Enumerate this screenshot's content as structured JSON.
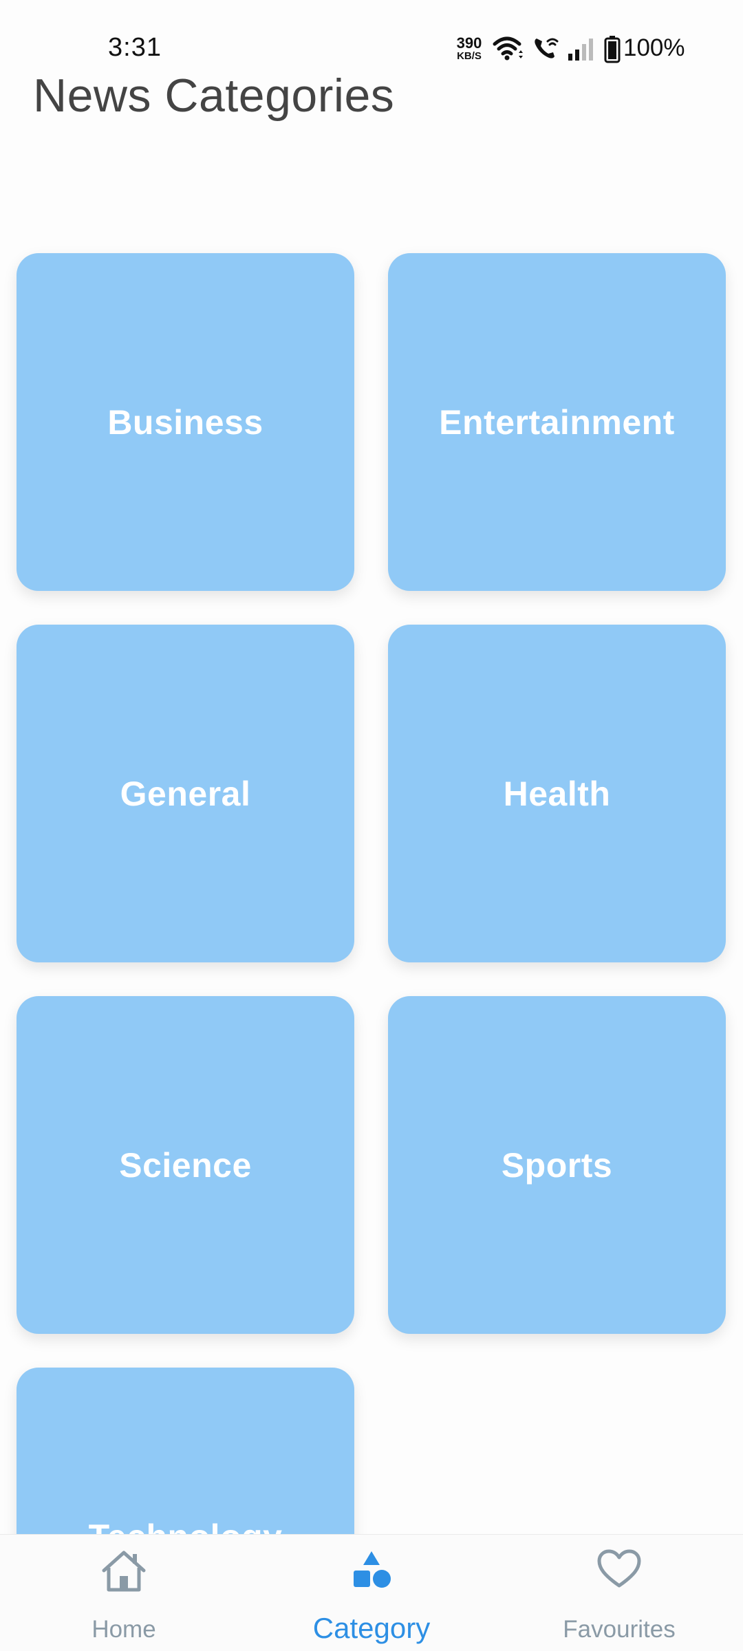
{
  "status_bar": {
    "time": "3:31",
    "net_speed_value": "390",
    "net_speed_unit": "KB/S",
    "battery_percent": "100%",
    "icons": [
      "wifi-icon",
      "wifi-call-icon",
      "signal-icon",
      "battery-icon"
    ]
  },
  "header": {
    "title": "News Categories"
  },
  "categories": [
    {
      "label": "Business"
    },
    {
      "label": "Entertainment"
    },
    {
      "label": "General"
    },
    {
      "label": "Health"
    },
    {
      "label": "Science"
    },
    {
      "label": "Sports"
    },
    {
      "label": "Technology"
    }
  ],
  "bottom_nav": {
    "items": [
      {
        "label": "Home",
        "icon": "home-icon",
        "active": false
      },
      {
        "label": "Category",
        "icon": "category-icon",
        "active": true
      },
      {
        "label": "Favourites",
        "icon": "heart-icon",
        "active": false
      }
    ]
  },
  "colors": {
    "tile": "#90c9f6",
    "accent": "#2d8fe4",
    "nav_inactive": "#8a9aa6",
    "title": "#444444"
  }
}
